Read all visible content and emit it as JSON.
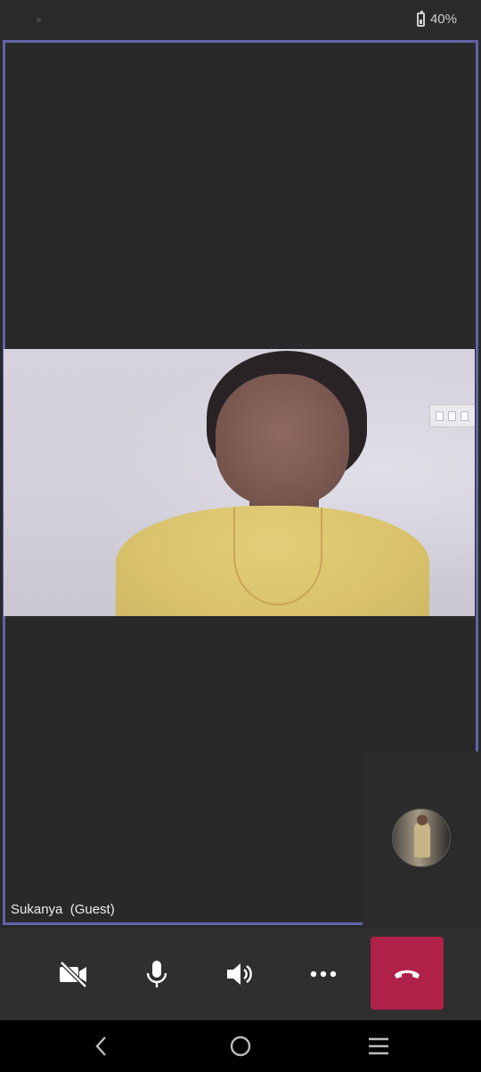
{
  "status_bar": {
    "battery_percent": "40%"
  },
  "call": {
    "participant_name": "Sukanya  (Guest)",
    "accent_color": "#6264a7",
    "end_call_color": "#b02149"
  },
  "controls": {
    "camera": "video-off-icon",
    "microphone": "microphone-icon",
    "speaker": "speaker-icon",
    "more": "more-options-icon",
    "end_call": "hang-up-icon"
  },
  "nav": {
    "back": "back-icon",
    "home": "home-icon",
    "recents": "menu-icon"
  }
}
